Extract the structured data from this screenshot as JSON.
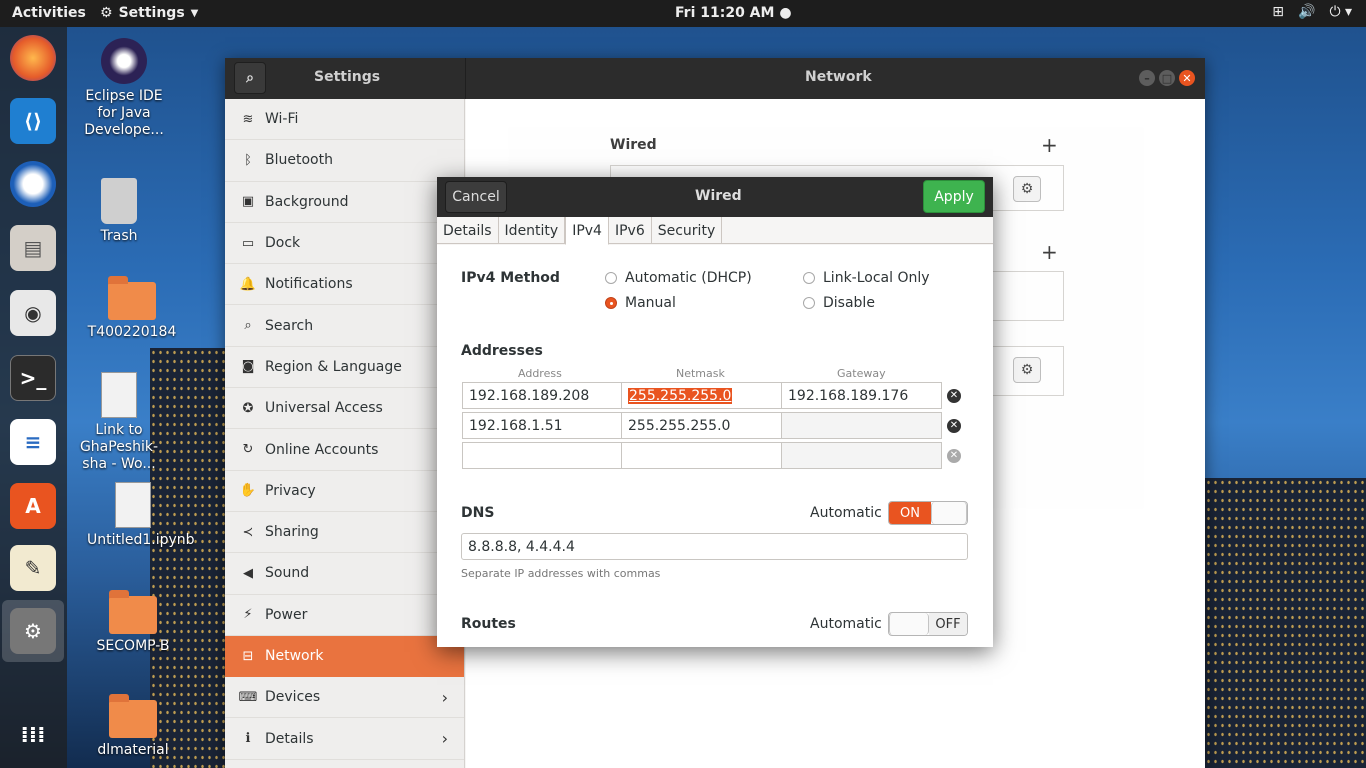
{
  "topbar": {
    "activities": "Activities",
    "app_name": "Settings",
    "clock": "Fri 11:20 AM ●"
  },
  "desktop": {
    "icons": [
      {
        "label": "Eclipse IDE for Java Develope..."
      },
      {
        "label": "Trash"
      },
      {
        "label": "T400220184"
      },
      {
        "label": "Link to GhaPeshik-sha - Wo..."
      },
      {
        "label": "Untitled1.ipynb"
      },
      {
        "label": "SECOMP-B"
      },
      {
        "label": "dlmaterial"
      }
    ]
  },
  "settings": {
    "title_left": "Settings",
    "title_right": "Network",
    "sidebar": [
      {
        "label": "Wi-Fi",
        "icon": "wifi-icon"
      },
      {
        "label": "Bluetooth",
        "icon": "bluetooth-icon"
      },
      {
        "label": "Background",
        "icon": "background-icon"
      },
      {
        "label": "Dock",
        "icon": "dock-icon"
      },
      {
        "label": "Notifications",
        "icon": "bell-icon"
      },
      {
        "label": "Search",
        "icon": "search-icon"
      },
      {
        "label": "Region & Language",
        "icon": "camera-icon"
      },
      {
        "label": "Universal Access",
        "icon": "accessibility-icon"
      },
      {
        "label": "Online Accounts",
        "icon": "online-accounts-icon"
      },
      {
        "label": "Privacy",
        "icon": "hand-icon"
      },
      {
        "label": "Sharing",
        "icon": "share-icon"
      },
      {
        "label": "Sound",
        "icon": "speaker-icon"
      },
      {
        "label": "Power",
        "icon": "power-icon"
      },
      {
        "label": "Network",
        "icon": "network-icon",
        "active": true
      },
      {
        "label": "Devices",
        "icon": "devices-icon",
        "chevron": true
      },
      {
        "label": "Details",
        "icon": "info-icon",
        "chevron": true
      }
    ],
    "content": {
      "wired_heading": "Wired"
    }
  },
  "dialog": {
    "cancel": "Cancel",
    "title": "Wired",
    "apply": "Apply",
    "tabs": [
      "Details",
      "Identity",
      "IPv4",
      "IPv6",
      "Security"
    ],
    "active_tab": "IPv4",
    "ipv4_method_label": "IPv4 Method",
    "methods": {
      "auto_dhcp": "Automatic (DHCP)",
      "link_local": "Link-Local Only",
      "manual": "Manual",
      "disable": "Disable",
      "selected": "Manual"
    },
    "addresses_label": "Addresses",
    "columns": {
      "address": "Address",
      "netmask": "Netmask",
      "gateway": "Gateway"
    },
    "rows": [
      {
        "address": "192.168.189.208",
        "netmask": "255.255.255.0",
        "gateway": "192.168.189.176"
      },
      {
        "address": "192.168.1.51",
        "netmask": "255.255.255.0",
        "gateway": ""
      },
      {
        "address": "",
        "netmask": "",
        "gateway": ""
      }
    ],
    "dns_label": "DNS",
    "dns_automatic_label": "Automatic",
    "dns_switch": "ON",
    "dns_value": "8.8.8.8, 4.4.4.4",
    "dns_hint": "Separate IP addresses with commas",
    "routes_label": "Routes",
    "routes_automatic_label": "Automatic",
    "routes_switch": "OFF"
  }
}
